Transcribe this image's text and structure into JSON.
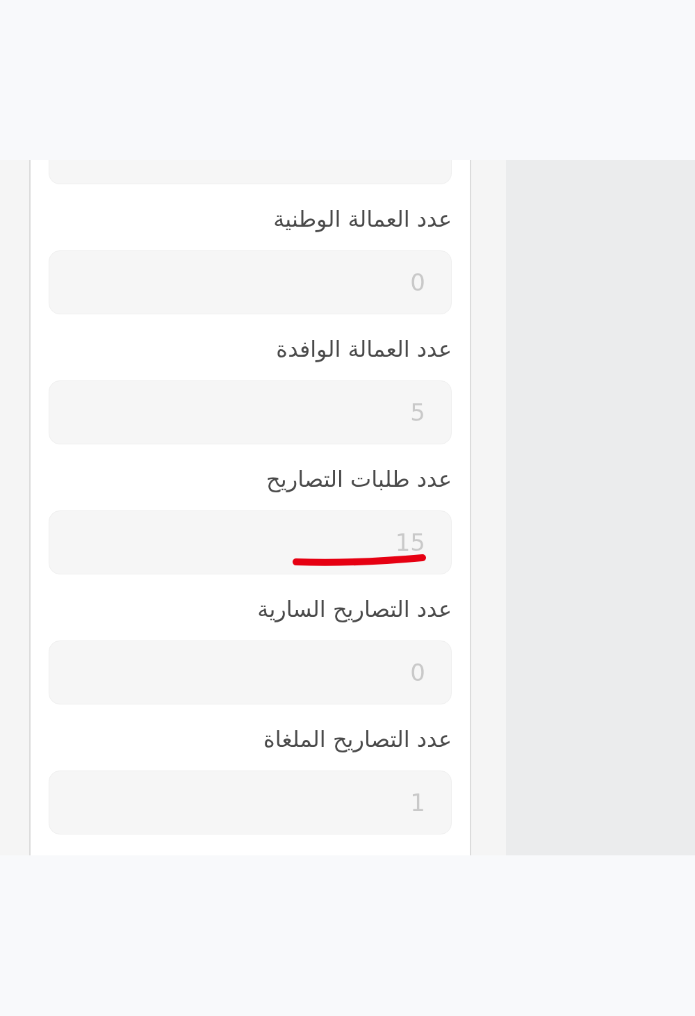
{
  "form": {
    "fields": [
      {
        "kind": "clipped",
        "disabled": true,
        "underlined": false
      },
      {
        "kind": "labeled",
        "label": "عدد العمالة الوطنية",
        "value": "0",
        "disabled": true,
        "underlined": false
      },
      {
        "kind": "labeled",
        "label": "عدد العمالة الوافدة",
        "value": "5",
        "disabled": true,
        "underlined": false
      },
      {
        "kind": "labeled",
        "label": "عدد طلبات التصاريح",
        "value": "15",
        "disabled": true,
        "underlined": true
      },
      {
        "kind": "labeled",
        "label": "عدد التصاريح السارية",
        "value": "0",
        "disabled": true,
        "underlined": false
      },
      {
        "kind": "labeled",
        "label": "عدد التصاريح الملغاة",
        "value": "1",
        "disabled": true,
        "underlined": false
      }
    ]
  }
}
